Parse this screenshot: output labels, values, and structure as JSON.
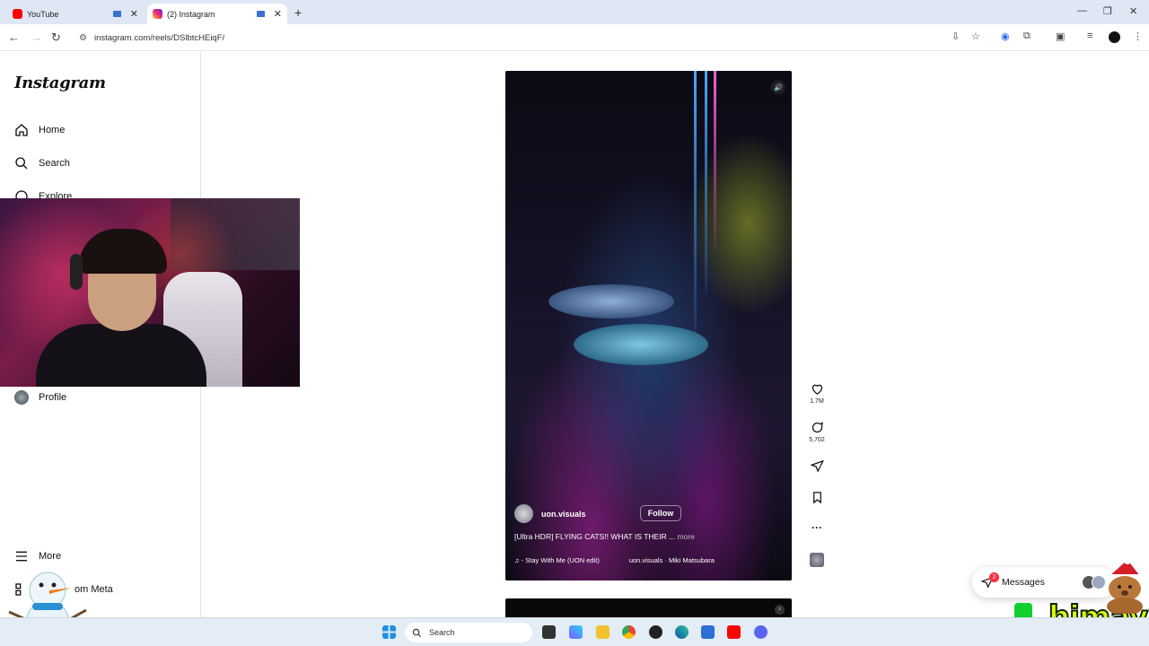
{
  "browser": {
    "tabs": [
      {
        "title": "YouTube",
        "color": "#ff0000"
      },
      {
        "title": "(2) Instagram",
        "color": "#d6249f"
      }
    ],
    "url": "instagram.com/reels/DSlbtcHEiqF/"
  },
  "sidebar": {
    "logo": "Instagram",
    "items": [
      {
        "label": "Home",
        "icon": "home-icon"
      },
      {
        "label": "Search",
        "icon": "search-icon"
      },
      {
        "label": "Explore",
        "icon": "explore-icon"
      },
      {
        "label": "Profile",
        "icon": "avatar"
      },
      {
        "label": "More",
        "icon": "menu-icon"
      },
      {
        "label": "om Meta",
        "icon": "grid-icon"
      }
    ]
  },
  "reel": {
    "username": "uon.visuals",
    "follow_label": "Follow",
    "caption": "[Ultra HDR] FLYING CATS!! WHAT IS THEIR ...",
    "more_label": "more",
    "audio_track": "- Stay With Me (UON edit)",
    "audio_credit": "uon.visuals · Miki Matsubara",
    "likes": "1.7M",
    "comments": "5,702"
  },
  "messages": {
    "label": "Messages",
    "badge": "2"
  },
  "overlay": {
    "streamer_tag": "himay"
  },
  "taskbar": {
    "search_placeholder": "Search"
  }
}
